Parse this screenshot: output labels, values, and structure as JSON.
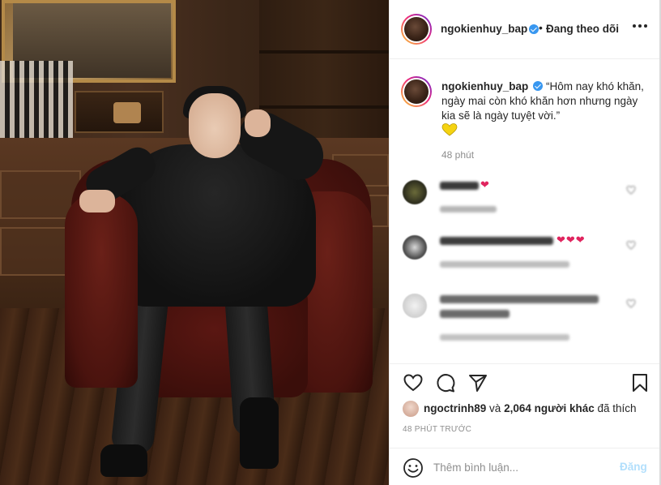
{
  "post": {
    "username": "ngokienhuy_bap",
    "separator": "•",
    "follow_label": "Đang theo dõi",
    "caption": "“Hôm nay khó khăn, ngày mai còn khó khăn hơn nhưng ngày kia sẽ là ngày tuyệt vời.”",
    "caption_emoji": "yellow-heart-icon",
    "caption_time": "48 phút"
  },
  "comments": [
    {
      "hearts": "❤"
    },
    {
      "hearts": "❤❤❤"
    },
    {
      "hearts": ""
    }
  ],
  "likes": {
    "first_liker": "ngoctrinh89",
    "connector": "và",
    "others": "2,064 người khác",
    "suffix": "đã thích"
  },
  "timestamp": "48 PHÚT TRƯỚC",
  "composer": {
    "placeholder": "Thêm bình luận...",
    "post_label": "Đăng"
  },
  "colors": {
    "verified_blue": "#3897f0",
    "text_primary": "#262626",
    "text_secondary": "#8e8e8e",
    "post_disabled": "#b2dffc",
    "heart_red": "#e0245e",
    "yellow_heart": "#f5d312"
  },
  "icons": [
    "more-options-icon",
    "verified-badge-icon",
    "heart-icon",
    "comment-icon",
    "share-icon",
    "bookmark-icon",
    "emoji-icon"
  ]
}
